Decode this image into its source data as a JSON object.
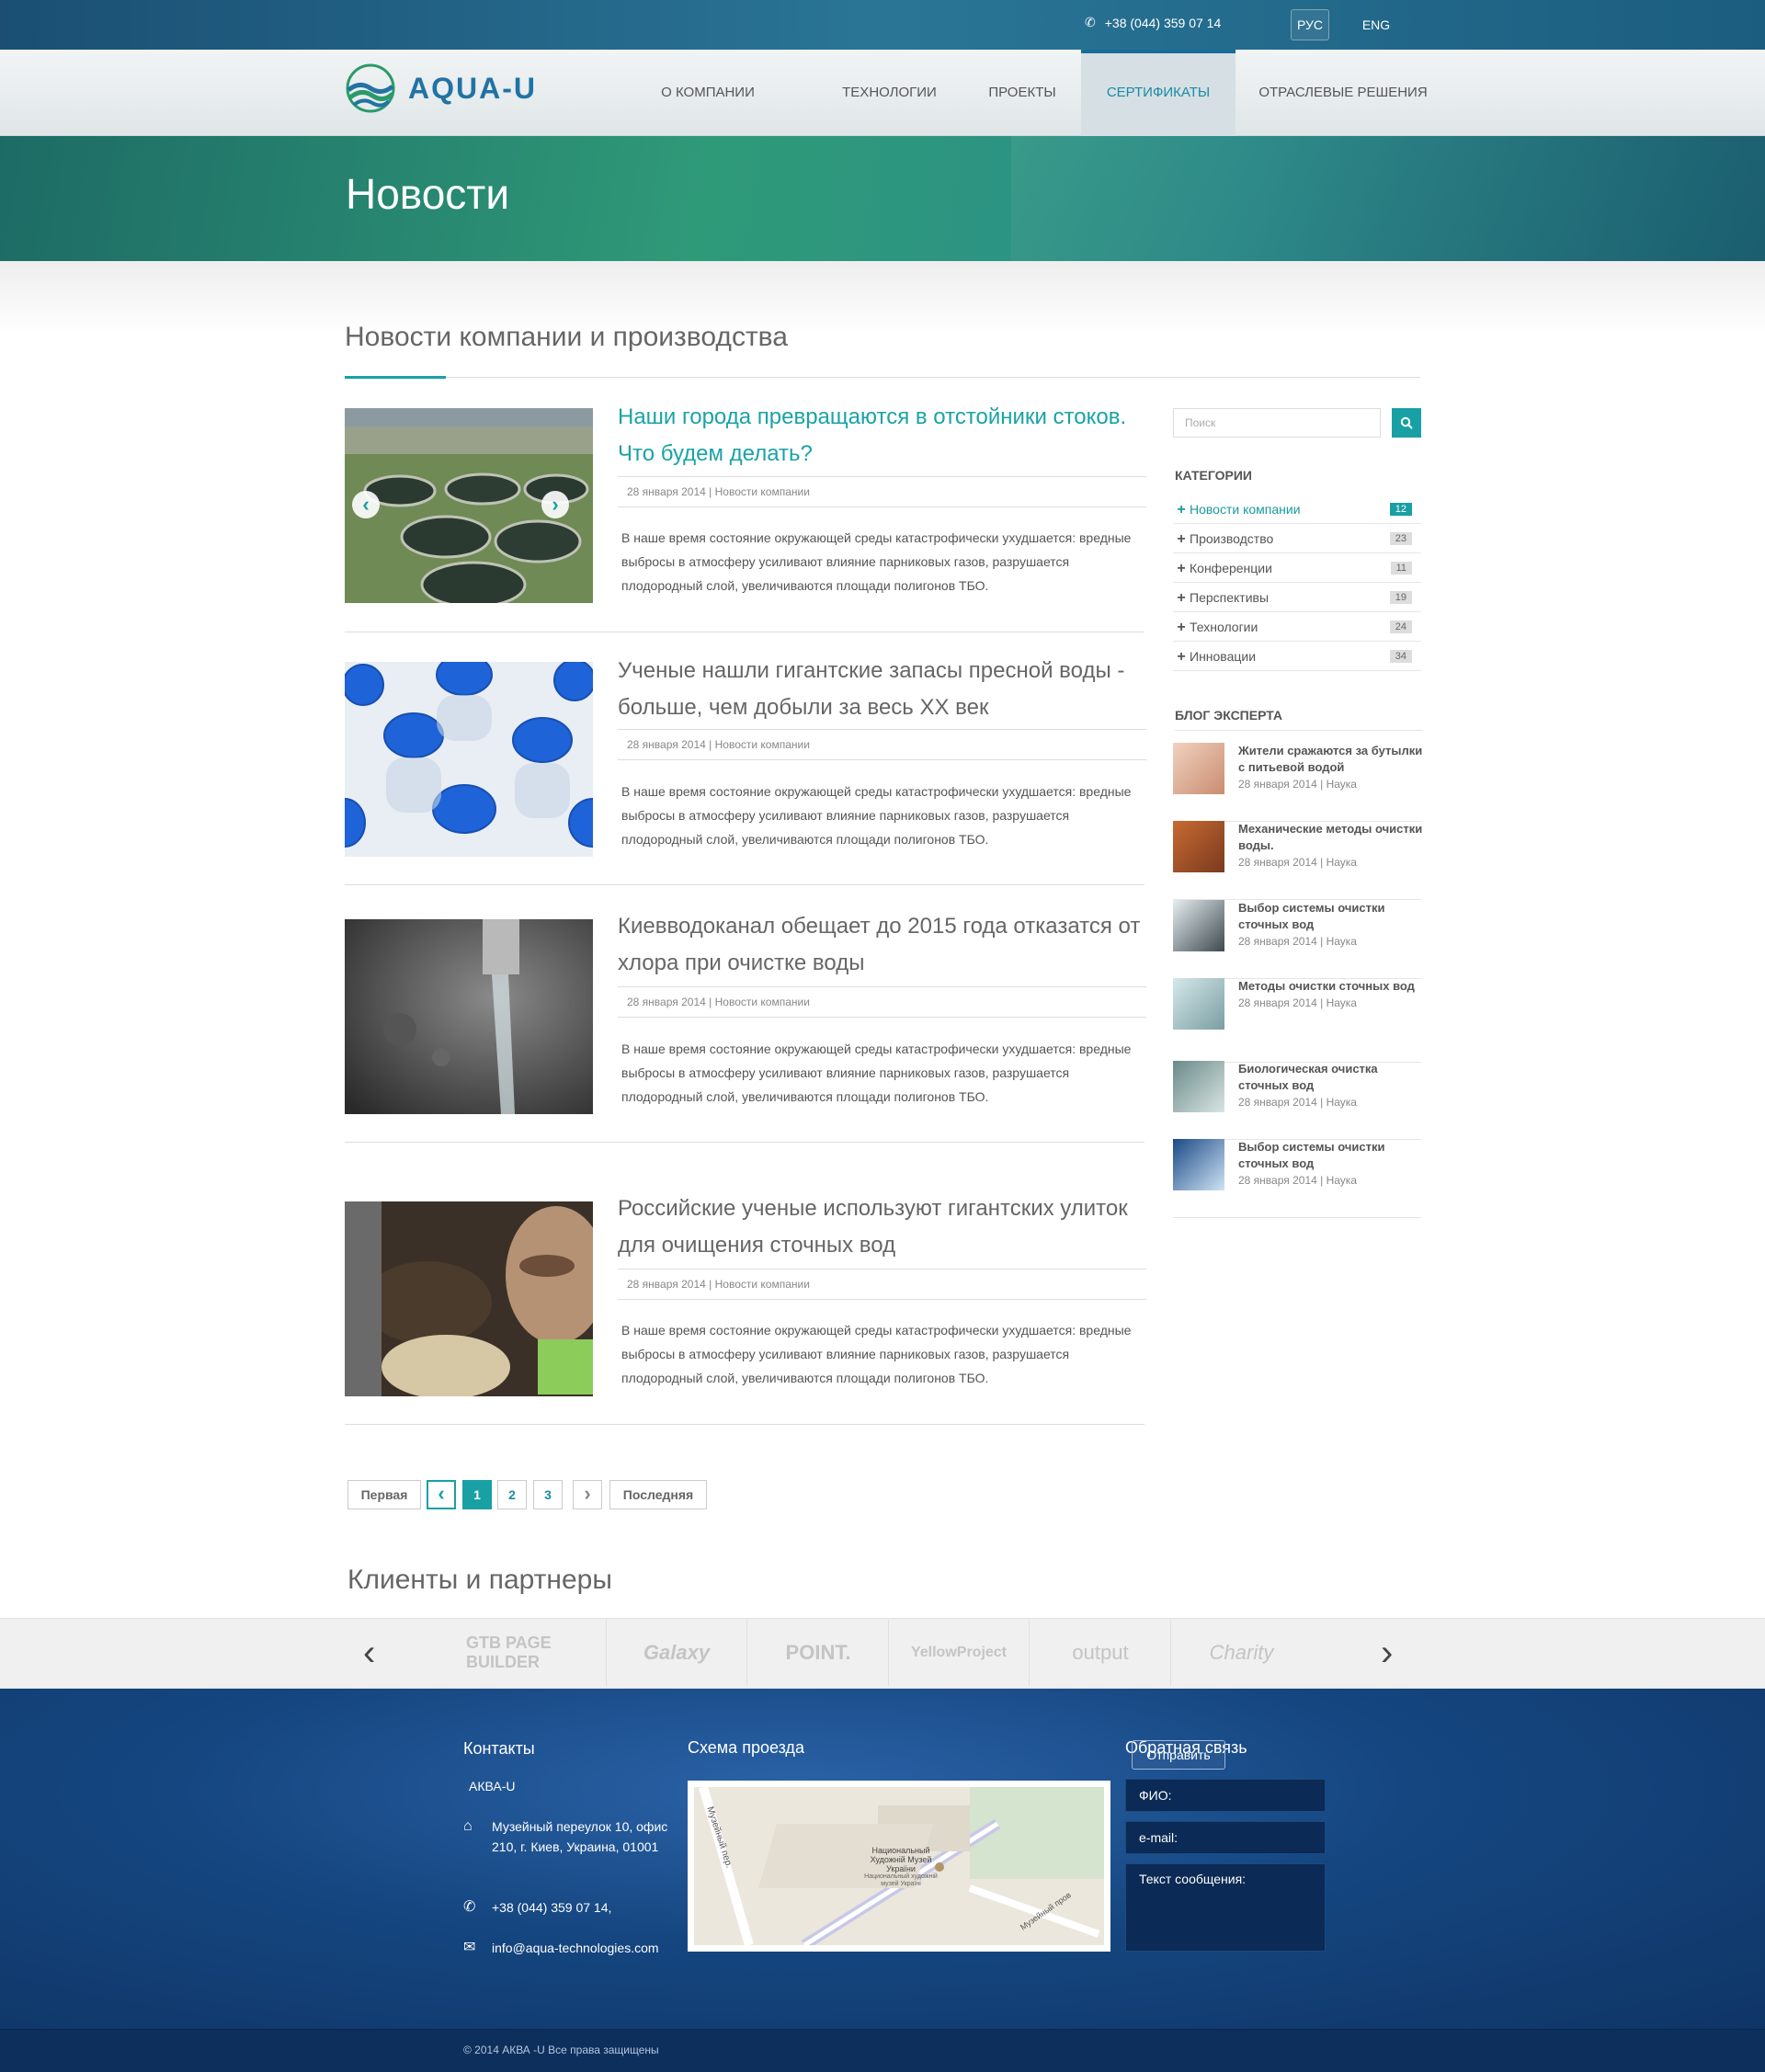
{
  "header": {
    "phone": "+38 (044) 359 07 14",
    "lang_ru": "РУС",
    "lang_en": "ENG",
    "logo_text": "AQUA-U"
  },
  "nav": {
    "items": [
      {
        "label": "О КОМПАНИИ"
      },
      {
        "label": "ТЕХНОЛОГИИ"
      },
      {
        "label": "ПРОЕКТЫ"
      },
      {
        "label": "СЕРТИФИКАТЫ"
      },
      {
        "label": "ОТРАСЛЕВЫЕ РЕШЕНИЯ"
      }
    ],
    "active_index": 3
  },
  "page_title": "Новости",
  "section_title": "Новости компании и производства",
  "articles": [
    {
      "title": "Наши города превращаются в отстойники  стоков. Что будем делать?",
      "date": "28 января 2014",
      "category": "Новости компании",
      "text": "В наше время состояние окружающей среды катастрофически ухудшается: вредные выбросы в атмосферу усиливают влияние парниковых газов, разрушается плодородный слой, увеличиваются площади полигонов ТБО."
    },
    {
      "title": "Ученые нашли гигантские запасы пресной воды - больше, чем добыли за весь XX век",
      "date": "28 января 2014",
      "category": "Новости компании",
      "text": "В наше время состояние окружающей среды катастрофически ухудшается: вредные выбросы в атмосферу усиливают влияние парниковых газов, разрушается плодородный слой, увеличиваются площади полигонов ТБО."
    },
    {
      "title": "Киевводоканал обещает до 2015 года отказатся от хлора при очистке воды",
      "date": "28 января 2014",
      "category": "Новости компании",
      "text": "В наше время состояние окружающей среды катастрофически ухудшается: вредные выбросы в атмосферу усиливают влияние парниковых газов, разрушается плодородный слой, увеличиваются площади полигонов ТБО."
    },
    {
      "title": "Российские ученые используют гигантских улиток для очищения сточных вод",
      "date": "28 января 2014",
      "category": "Новости компании",
      "text": "В наше время состояние окружающей среды катастрофически ухудшается: вредные выбросы в атмосферу усиливают влияние парниковых газов, разрушается плодородный слой, увеличиваются площади полигонов ТБО."
    }
  ],
  "meta_separator": "|",
  "pagination": {
    "first": "Первая",
    "last": "Последняя",
    "pages": [
      "1",
      "2",
      "3"
    ],
    "current": "1",
    "prev": "‹",
    "next": "›"
  },
  "sidebar": {
    "search_placeholder": "Поиск",
    "categories_title": "КАТЕГОРИИ",
    "categories": [
      {
        "label": "Новости компании",
        "count": "12",
        "active": true
      },
      {
        "label": "Производство",
        "count": "23"
      },
      {
        "label": "Конференции",
        "count": "11"
      },
      {
        "label": "Перспективы",
        "count": "19"
      },
      {
        "label": "Технологии",
        "count": "24"
      },
      {
        "label": "Инновации",
        "count": "34"
      }
    ],
    "blog_title": "БЛОГ ЭКСПЕРТА",
    "blog": [
      {
        "title": "Жители сражаются за бутылки с питьевой водой",
        "meta": "28 января 2014 | Наука"
      },
      {
        "title": "Механические методы очистки воды.",
        "meta": "28 января 2014 | Наука"
      },
      {
        "title": "Выбор системы очистки сточных вод",
        "meta": "28 января 2014 | Наука"
      },
      {
        "title": "Методы очистки сточных вод",
        "meta": "28 января 2014 | Наука"
      },
      {
        "title": " Биологическая очистка сточных вод",
        "meta": "28 января 2014 | Наука"
      },
      {
        "title": "Выбор системы очистки сточных вод",
        "meta": "28 января 2014 | Наука"
      }
    ]
  },
  "clients": {
    "title": "Клиенты и партнеры",
    "logos": [
      "GTB PAGE BUILDER",
      "Galaxy",
      "POINT.",
      "YellowProject",
      "output",
      "Charity"
    ]
  },
  "footer": {
    "contacts_title": "Контакты",
    "company": "АКВА-U",
    "address": "Музейный переулок 10, офис 210,  г. Киев, Украина, 01001",
    "phone": "+38 (044) 359 07 14,",
    "email": "info@aqua-technologies.com",
    "map_title": "Схема проезда",
    "map_labels": [
      "Музейный пер.",
      "Национальный Художній Музей України",
      "Национальный художній музей Україні",
      "Музейный пров"
    ],
    "feedback_title": "Обратная связь",
    "send_label": "Отправить",
    "fio_placeholder": "ФИО:",
    "email_placeholder": "e-mail:",
    "message_placeholder": "Текст сообщения:",
    "copyright": "© 2014  АКВА -U  Все права защищены"
  },
  "colors": {
    "accent": "#19a0a4",
    "header_blue": "#2273a3",
    "footer_blue": "#154680"
  }
}
